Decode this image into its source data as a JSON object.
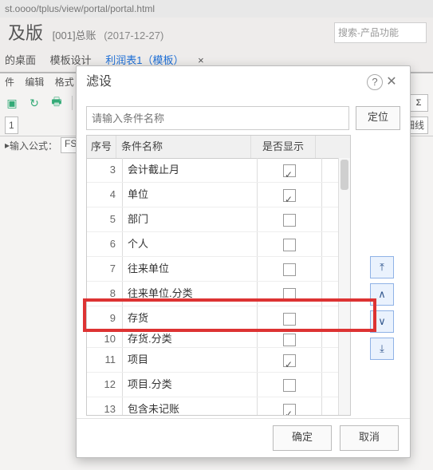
{
  "address_fragment": "st.oooo/tplus/view/portal/portal.html",
  "app": {
    "edition_suffix": "及版",
    "account_code": "[001]总账",
    "account_date": "(2017-12-27)",
    "search_placeholder": "搜索-产品功能"
  },
  "tabs": {
    "desktop": "的桌面",
    "template": "模板设计",
    "active": "利润表1（模板）",
    "close_x": "×"
  },
  "menu": {
    "file": "件",
    "edit": "编辑",
    "format": "格式"
  },
  "toolbar": {
    "sum_btn": "Σ"
  },
  "cellbar": {
    "detail_btn": "细线"
  },
  "formula": {
    "label": "输入公式：",
    "value": "FS"
  },
  "dialog": {
    "title": "滤设",
    "help_icon": "?",
    "close_icon": "✕",
    "search_placeholder": "请输入条件名称",
    "locate_btn": "定位",
    "col_index": "序号",
    "col_name": "条件名称",
    "col_show": "是否显示",
    "rows": [
      {
        "idx": "3",
        "name": "会计截止月",
        "show": true
      },
      {
        "idx": "4",
        "name": "单位",
        "show": true
      },
      {
        "idx": "5",
        "name": "部门",
        "show": false
      },
      {
        "idx": "6",
        "name": "个人",
        "show": false
      },
      {
        "idx": "7",
        "name": "往来单位",
        "show": false
      },
      {
        "idx": "8",
        "name": "往来单位.分类",
        "show": false
      },
      {
        "idx": "9",
        "name": "存货",
        "show": false
      },
      {
        "idx": "10",
        "name": "存货.分类",
        "show": false
      },
      {
        "idx": "11",
        "name": "项目",
        "show": true
      },
      {
        "idx": "12",
        "name": "项目.分类",
        "show": false
      },
      {
        "idx": "13",
        "name": "包含未记账",
        "show": true
      }
    ],
    "arrows": {
      "top": "⤒",
      "up": "∧",
      "down": "∨",
      "bottom": "⤓"
    },
    "ok": "确定",
    "cancel": "取消"
  }
}
